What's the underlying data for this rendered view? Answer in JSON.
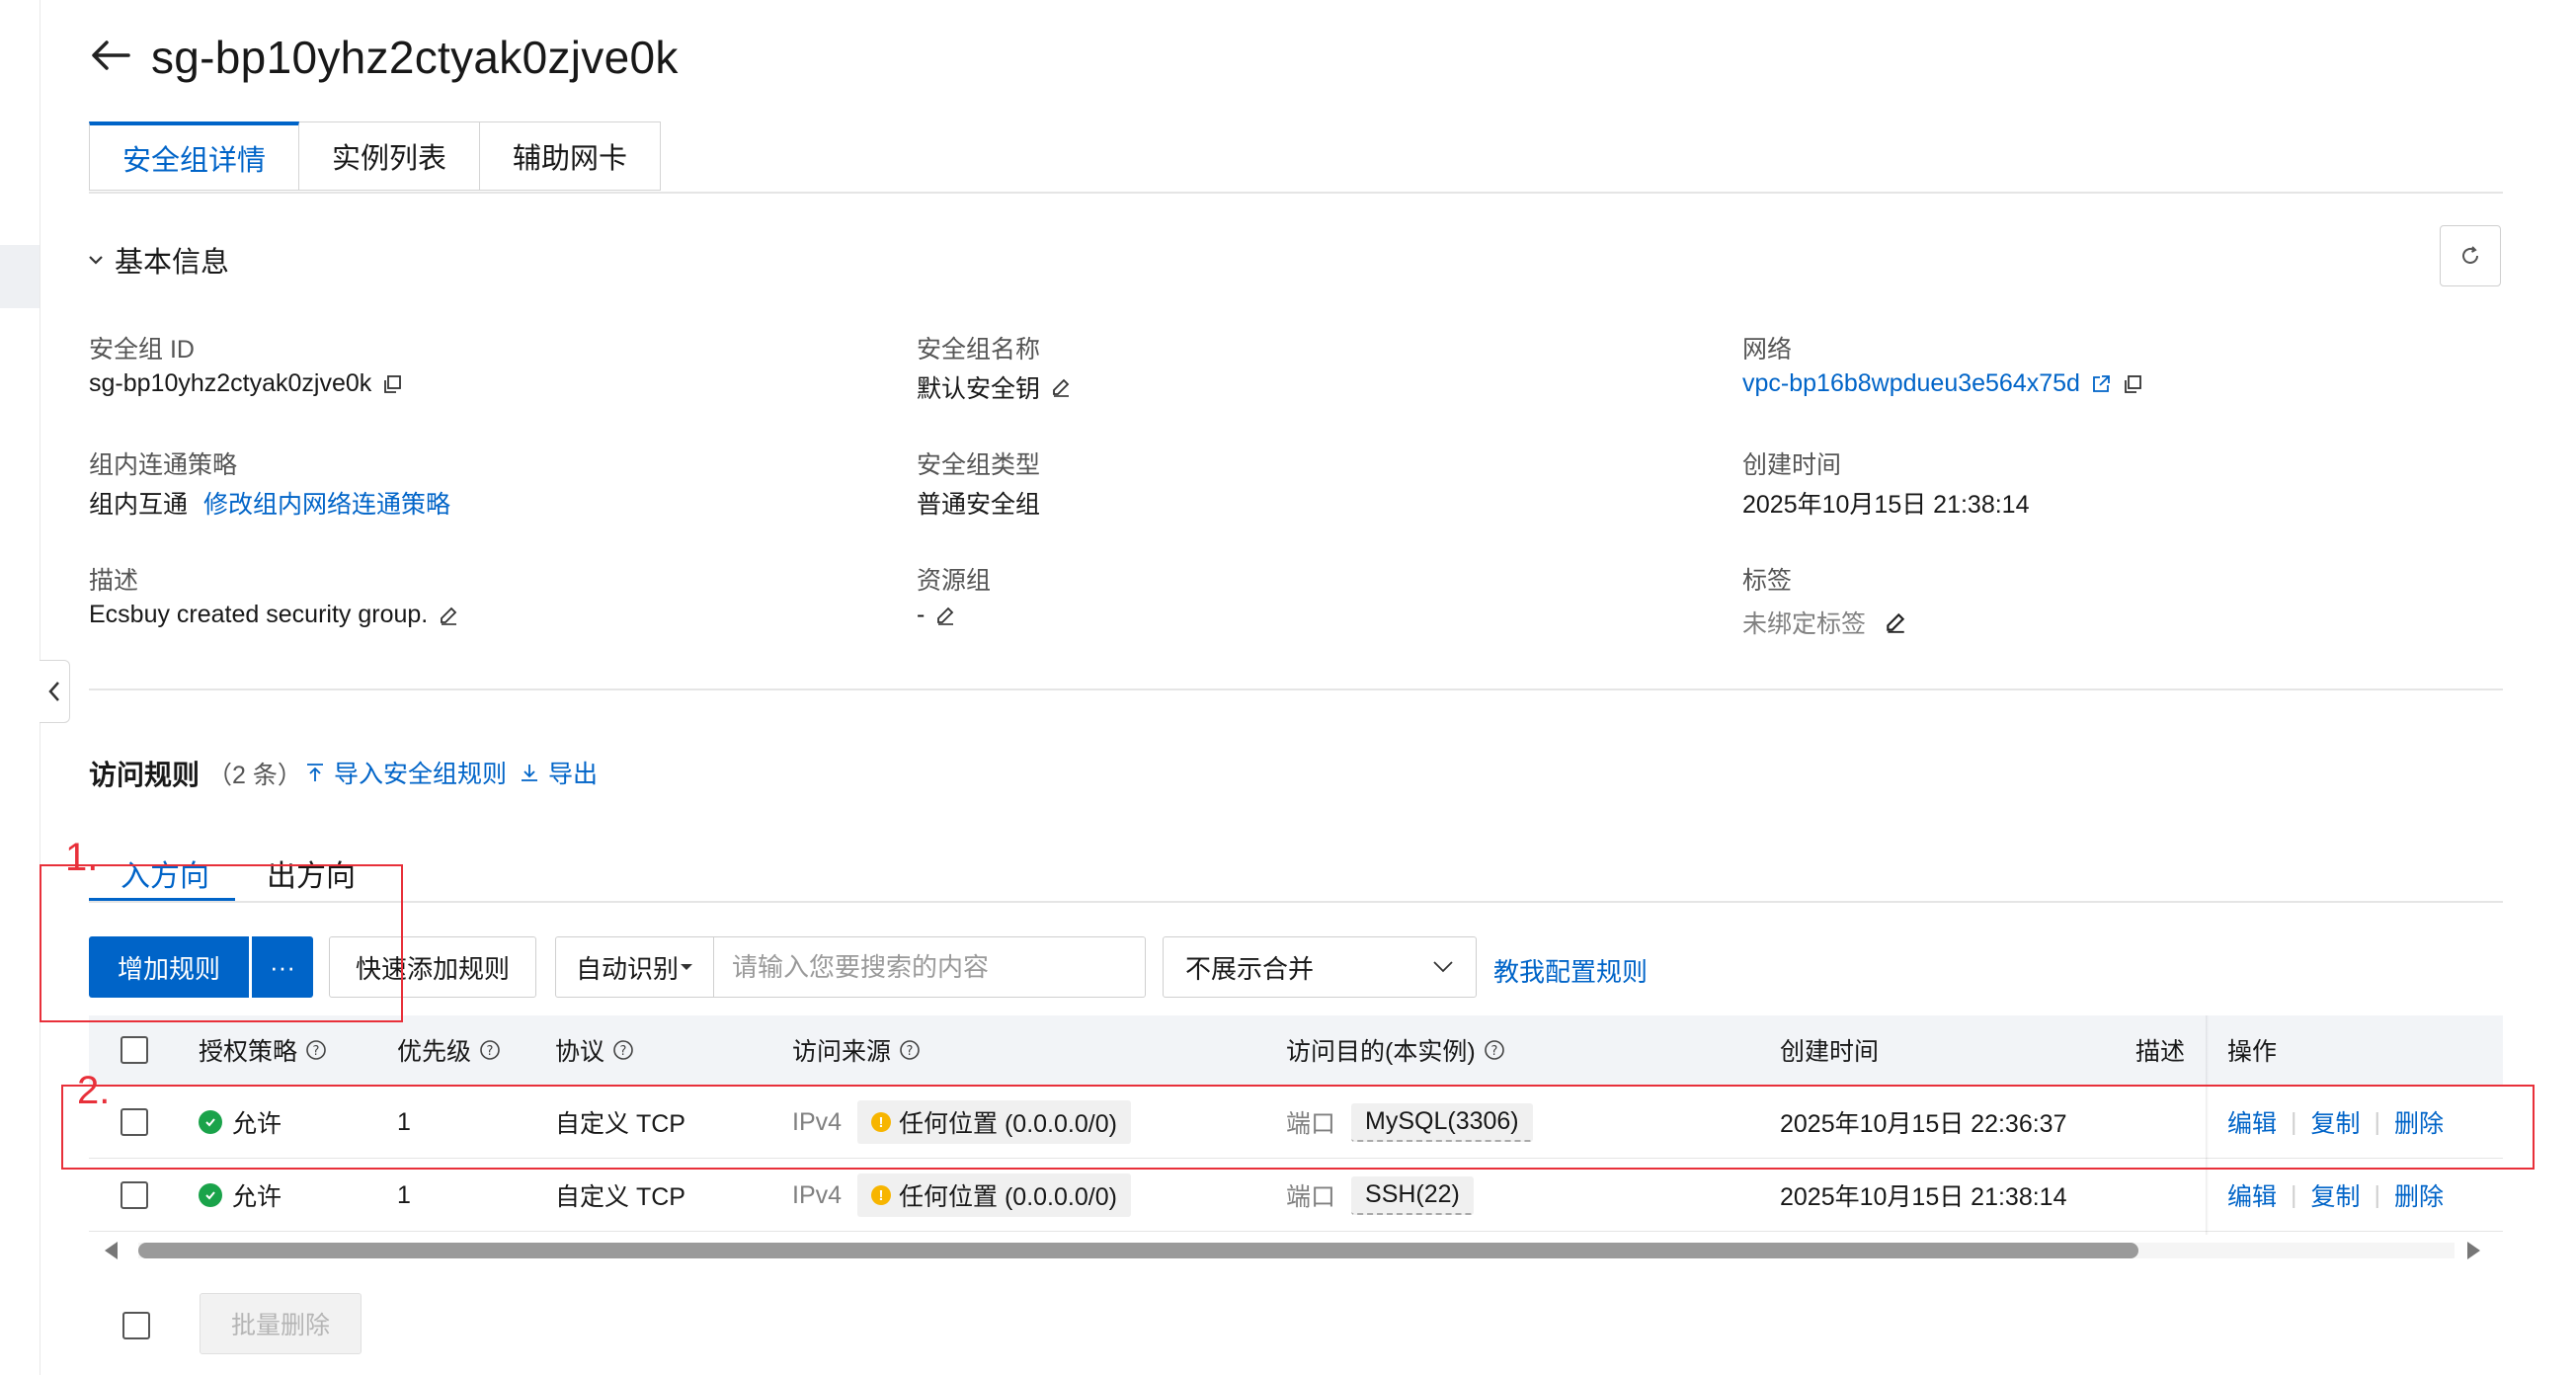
{
  "header": {
    "title": "sg-bp10yhz2ctyak0zjve0k"
  },
  "tabs": [
    {
      "label": "安全组详情",
      "active": true
    },
    {
      "label": "实例列表",
      "active": false
    },
    {
      "label": "辅助网卡",
      "active": false
    }
  ],
  "basic_info": {
    "section_title": "基本信息",
    "fields": {
      "sg_id": {
        "label": "安全组 ID",
        "value": "sg-bp10yhz2ctyak0zjve0k"
      },
      "sg_name": {
        "label": "安全组名称",
        "value": "默认安全钥"
      },
      "network": {
        "label": "网络",
        "value": "vpc-bp16b8wpdueu3e564x75d"
      },
      "policy": {
        "label": "组内连通策略",
        "value": "组内互通",
        "link": "修改组内网络连通策略"
      },
      "sg_type": {
        "label": "安全组类型",
        "value": "普通安全组"
      },
      "created": {
        "label": "创建时间",
        "value": "2025年10月15日 21:38:14"
      },
      "description": {
        "label": "描述",
        "value": "Ecsbuy created security group."
      },
      "resource_group": {
        "label": "资源组",
        "value": "-"
      },
      "tags": {
        "label": "标签",
        "value": "未绑定标签"
      }
    }
  },
  "rules": {
    "title": "访问规则",
    "count": "（2 条）",
    "import_label": "导入安全组规则",
    "export_label": "导出",
    "direction_tabs": [
      {
        "label": "入方向",
        "active": true
      },
      {
        "label": "出方向",
        "active": false
      }
    ],
    "toolbar": {
      "add_label": "增加规则",
      "more_label": "···",
      "quick_add_label": "快速添加规则",
      "search_type": "自动识别",
      "search_placeholder": "请输入您要搜索的内容",
      "merge_select": "不展示合并",
      "teach_link": "教我配置规则"
    },
    "columns": [
      "授权策略",
      "优先级",
      "协议",
      "访问来源",
      "访问目的(本实例)",
      "创建时间",
      "描述",
      "操作"
    ],
    "rows": [
      {
        "policy": "允许",
        "priority": "1",
        "protocol": "自定义 TCP",
        "source_type": "IPv4",
        "source": "任何位置 (0.0.0.0/0)",
        "dest_label": "端口",
        "dest": "MySQL(3306)",
        "created": "2025年10月15日 22:36:37",
        "description": "",
        "actions": [
          "编辑",
          "复制",
          "删除"
        ]
      },
      {
        "policy": "允许",
        "priority": "1",
        "protocol": "自定义 TCP",
        "source_type": "IPv4",
        "source": "任何位置 (0.0.0.0/0)",
        "dest_label": "端口",
        "dest": "SSH(22)",
        "created": "2025年10月15日 21:38:14",
        "description": "",
        "actions": [
          "编辑",
          "复制",
          "删除"
        ]
      }
    ],
    "bulk_delete_label": "批量删除"
  },
  "annotations": {
    "first": "1.",
    "second": "2."
  },
  "colors": {
    "primary": "#0064c8",
    "annotation": "#e8303a",
    "success": "#1aa34a",
    "warning": "#f7b500"
  }
}
